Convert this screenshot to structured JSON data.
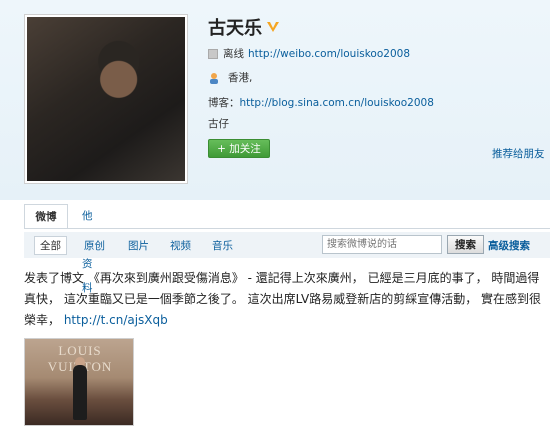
{
  "profile": {
    "name": "古天乐",
    "status_label": "离线",
    "weibo_url": "http://weibo.com/louiskoo2008",
    "location": "香港,",
    "blog_label": "博客：",
    "blog_url": "http://blog.sina.com.cn/louiskoo2008",
    "nickname": "古仔",
    "follow_label": "+ 加关注",
    "recommend_label": "推荐给朋友"
  },
  "tabs": [
    {
      "label": "微博"
    },
    {
      "label": "他的资料"
    }
  ],
  "filters": [
    {
      "label": "全部"
    },
    {
      "label": "原创"
    },
    {
      "label": "图片"
    },
    {
      "label": "视频"
    },
    {
      "label": "音乐"
    }
  ],
  "search": {
    "placeholder": "搜索微博说的话",
    "button_label": "搜索",
    "advanced_label": "高级搜索"
  },
  "post": {
    "text": "发表了博文 《再次來到廣州跟受傷消息》 - 還記得上次來廣州， 已經是三月底的事了， 時間過得真快， 這次重臨又已是一個季節之後了。 這次出席LV路易威登新店的剪綵宣傳活動， 實在感到很榮幸， ",
    "link": "http://t.cn/ajsXqb",
    "image_text": "LOUIS VUITTON"
  }
}
